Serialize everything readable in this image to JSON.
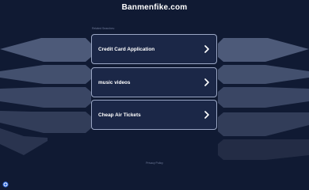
{
  "site": {
    "title": "Banmenfike.com"
  },
  "related": {
    "label": "Related Searches:"
  },
  "links": [
    {
      "label": "Credit Card Application",
      "icon": "chevron-right-icon"
    },
    {
      "label": "music videos",
      "icon": "chevron-right-icon"
    },
    {
      "label": "Cheap Air Tickets",
      "icon": "chevron-right-icon"
    }
  ],
  "footer": {
    "privacy_label": "Privacy Policy"
  },
  "colors": {
    "background": "#101a33",
    "link_fill": "#1b2747",
    "link_border": "#9aa6c4",
    "band_1": "#4d5a79",
    "band_2": "#43506e",
    "band_3": "#3a4664",
    "band_4": "#323d59",
    "band_5": "#2a344f",
    "band_6": "#232c45",
    "badge": "#2b66d9"
  }
}
